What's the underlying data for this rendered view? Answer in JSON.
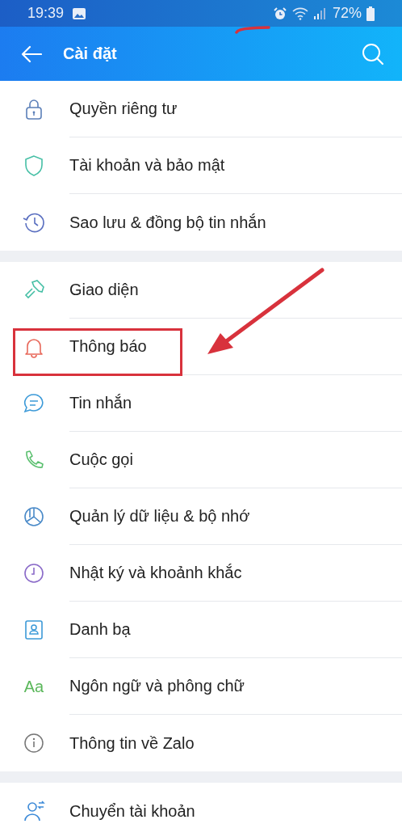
{
  "status_bar": {
    "time": "19:39",
    "battery": "72%"
  },
  "pen_mark": true,
  "header": {
    "title": "Cài đặt"
  },
  "sections": [
    {
      "items": [
        {
          "label": "Quyền riêng tư",
          "highlighted": false
        },
        {
          "label": "Tài khoản và bảo mật",
          "highlighted": false
        },
        {
          "label": "Sao lưu & đồng bộ tin nhắn",
          "highlighted": false
        }
      ]
    },
    {
      "items": [
        {
          "label": "Giao diện",
          "highlighted": false
        },
        {
          "label": "Thông báo",
          "highlighted": true
        },
        {
          "label": "Tin nhắn",
          "highlighted": false
        },
        {
          "label": "Cuộc gọi",
          "highlighted": false
        },
        {
          "label": "Quản lý dữ liệu & bộ nhớ",
          "highlighted": false
        },
        {
          "label": "Nhật ký và khoảnh khắc",
          "highlighted": false
        },
        {
          "label": "Danh bạ",
          "highlighted": false
        },
        {
          "label": "Ngôn ngữ và phông chữ",
          "icon_text": "Aa",
          "highlighted": false
        },
        {
          "label": "Thông tin về Zalo",
          "highlighted": false
        }
      ]
    },
    {
      "items": [
        {
          "label": "Chuyển tài khoản",
          "highlighted": false
        }
      ]
    }
  ]
}
